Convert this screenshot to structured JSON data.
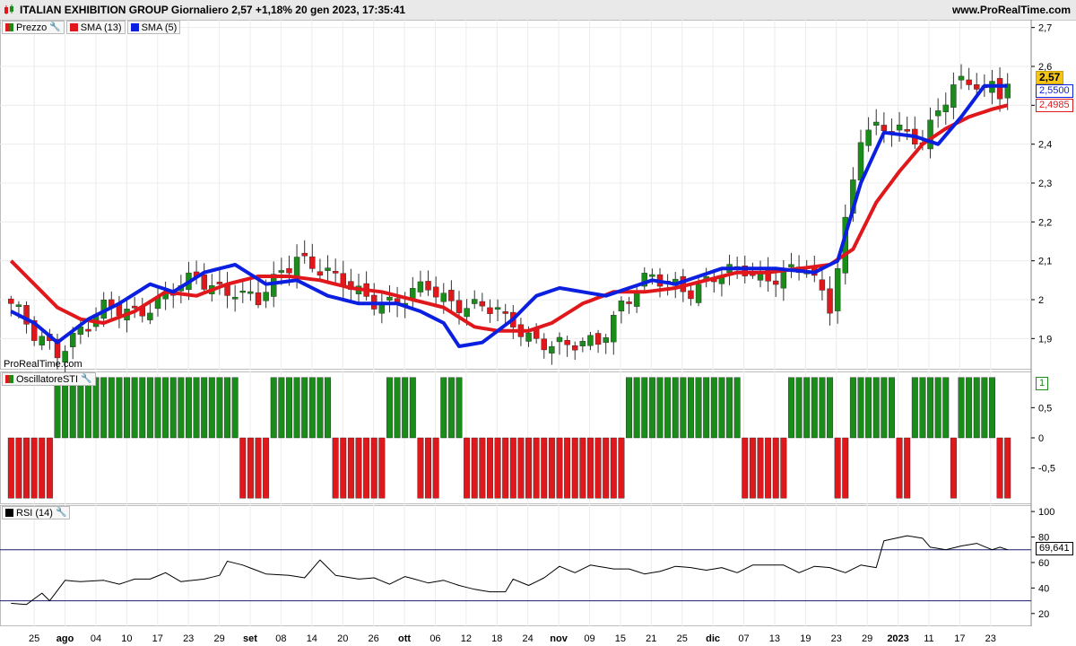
{
  "header": {
    "title": "ITALIAN EXHIBITION GROUP Giornaliero 2,57 +1,18% 20 gen 2023, 17:35:41",
    "site": "www.ProRealTime.com"
  },
  "watermark": "ProRealTime.com",
  "colors": {
    "up": "#1a8c1a",
    "down": "#e0171b",
    "sma13": "#e0171b",
    "sma5": "#0a1fe0",
    "rsi": "#000000",
    "axis": "#000000",
    "last_price_badge": "#f5c518"
  },
  "panels": {
    "price": {
      "legend": [
        {
          "label": "Prezzo",
          "icon": "candle-icon",
          "color": "#1a8c1a"
        },
        {
          "label": "SMA (13)",
          "color": "#e0171b"
        },
        {
          "label": "SMA (5)",
          "color": "#0a1fe0"
        }
      ],
      "yticks": [
        "2,7",
        "2,6",
        "2,5",
        "2,4",
        "2,3",
        "2,2",
        "2,1",
        "2",
        "1,9"
      ],
      "badges": {
        "last": "2,57",
        "sma5": "2,5500",
        "sma13": "2,4985"
      }
    },
    "osc": {
      "legend": [
        {
          "label": "OscillatoreSTI",
          "color": "#e0171b"
        }
      ],
      "yticks": [
        "0,5",
        "0",
        "-0,5"
      ],
      "badge": "1"
    },
    "rsi": {
      "legend": [
        {
          "label": "RSI (14)",
          "color": "#000000"
        }
      ],
      "yticks": [
        "100",
        "80",
        "60",
        "40",
        "20"
      ],
      "badge": "69,641"
    }
  },
  "xaxis": [
    {
      "label": "25",
      "bold": false
    },
    {
      "label": "ago",
      "bold": true
    },
    {
      "label": "04",
      "bold": false
    },
    {
      "label": "10",
      "bold": false
    },
    {
      "label": "17",
      "bold": false
    },
    {
      "label": "23",
      "bold": false
    },
    {
      "label": "29",
      "bold": false
    },
    {
      "label": "set",
      "bold": true
    },
    {
      "label": "08",
      "bold": false
    },
    {
      "label": "14",
      "bold": false
    },
    {
      "label": "20",
      "bold": false
    },
    {
      "label": "26",
      "bold": false
    },
    {
      "label": "ott",
      "bold": true
    },
    {
      "label": "06",
      "bold": false
    },
    {
      "label": "12",
      "bold": false
    },
    {
      "label": "18",
      "bold": false
    },
    {
      "label": "24",
      "bold": false
    },
    {
      "label": "nov",
      "bold": true
    },
    {
      "label": "09",
      "bold": false
    },
    {
      "label": "15",
      "bold": false
    },
    {
      "label": "21",
      "bold": false
    },
    {
      "label": "25",
      "bold": false
    },
    {
      "label": "dic",
      "bold": true
    },
    {
      "label": "07",
      "bold": false
    },
    {
      "label": "13",
      "bold": false
    },
    {
      "label": "19",
      "bold": false
    },
    {
      "label": "23",
      "bold": false
    },
    {
      "label": "29",
      "bold": false
    },
    {
      "label": "2023",
      "bold": true
    },
    {
      "label": "11",
      "bold": false
    },
    {
      "label": "17",
      "bold": false
    },
    {
      "label": "23",
      "bold": false
    }
  ],
  "chart_data": {
    "type": "candlestick",
    "n_bars": 130,
    "ylim": [
      1.82,
      2.72
    ],
    "price_points": [
      [
        0,
        1.99
      ],
      [
        3,
        1.9
      ],
      [
        6,
        1.87
      ],
      [
        9,
        1.93
      ],
      [
        12,
        1.97
      ],
      [
        16,
        1.97
      ],
      [
        20,
        2.01
      ],
      [
        24,
        2.05
      ],
      [
        28,
        2.03
      ],
      [
        32,
        1.99
      ],
      [
        37,
        2.12
      ],
      [
        42,
        2.05
      ],
      [
        46,
        2.01
      ],
      [
        50,
        1.99
      ],
      [
        54,
        2.03
      ],
      [
        57,
        2.0
      ],
      [
        62,
        1.97
      ],
      [
        65,
        1.94
      ],
      [
        68,
        1.9
      ],
      [
        72,
        1.87
      ],
      [
        76,
        1.9
      ],
      [
        79,
        1.99
      ],
      [
        82,
        2.04
      ],
      [
        85,
        2.05
      ],
      [
        88,
        2.03
      ],
      [
        91,
        2.05
      ],
      [
        95,
        2.08
      ],
      [
        98,
        2.06
      ],
      [
        103,
        2.07
      ],
      [
        106,
        1.99
      ],
      [
        110,
        2.42
      ],
      [
        115,
        2.44
      ],
      [
        118,
        2.42
      ],
      [
        122,
        2.54
      ],
      [
        125,
        2.56
      ],
      [
        126,
        2.55
      ],
      [
        127,
        2.56
      ],
      [
        128,
        2.54
      ],
      [
        129,
        2.57
      ]
    ],
    "sma5_points": [
      [
        0,
        1.97
      ],
      [
        3,
        1.94
      ],
      [
        6,
        1.89
      ],
      [
        10,
        1.95
      ],
      [
        14,
        1.99
      ],
      [
        18,
        2.04
      ],
      [
        21,
        2.02
      ],
      [
        25,
        2.07
      ],
      [
        29,
        2.09
      ],
      [
        33,
        2.04
      ],
      [
        37,
        2.05
      ],
      [
        41,
        2.01
      ],
      [
        45,
        1.99
      ],
      [
        50,
        1.99
      ],
      [
        53,
        1.97
      ],
      [
        56,
        1.94
      ],
      [
        58,
        1.88
      ],
      [
        61,
        1.89
      ],
      [
        65,
        1.95
      ],
      [
        68,
        2.01
      ],
      [
        71,
        2.03
      ],
      [
        74,
        2.02
      ],
      [
        77,
        2.01
      ],
      [
        80,
        2.03
      ],
      [
        83,
        2.05
      ],
      [
        86,
        2.04
      ],
      [
        89,
        2.06
      ],
      [
        92,
        2.08
      ],
      [
        95,
        2.08
      ],
      [
        99,
        2.08
      ],
      [
        104,
        2.07
      ],
      [
        107,
        2.1
      ],
      [
        110,
        2.3
      ],
      [
        113,
        2.43
      ],
      [
        117,
        2.42
      ],
      [
        120,
        2.4
      ],
      [
        123,
        2.47
      ],
      [
        126,
        2.55
      ],
      [
        129,
        2.55
      ]
    ],
    "sma13_points": [
      [
        0,
        2.1
      ],
      [
        3,
        2.04
      ],
      [
        6,
        1.98
      ],
      [
        9,
        1.95
      ],
      [
        12,
        1.94
      ],
      [
        16,
        1.97
      ],
      [
        20,
        2.02
      ],
      [
        24,
        2.01
      ],
      [
        28,
        2.04
      ],
      [
        32,
        2.06
      ],
      [
        36,
        2.06
      ],
      [
        40,
        2.05
      ],
      [
        44,
        2.03
      ],
      [
        48,
        2.02
      ],
      [
        52,
        2.0
      ],
      [
        56,
        1.98
      ],
      [
        60,
        1.93
      ],
      [
        63,
        1.92
      ],
      [
        67,
        1.92
      ],
      [
        70,
        1.94
      ],
      [
        74,
        1.99
      ],
      [
        78,
        2.02
      ],
      [
        82,
        2.02
      ],
      [
        86,
        2.03
      ],
      [
        90,
        2.05
      ],
      [
        94,
        2.07
      ],
      [
        98,
        2.07
      ],
      [
        102,
        2.08
      ],
      [
        106,
        2.09
      ],
      [
        109,
        2.13
      ],
      [
        112,
        2.25
      ],
      [
        115,
        2.33
      ],
      [
        118,
        2.4
      ],
      [
        121,
        2.44
      ],
      [
        124,
        2.47
      ],
      [
        127,
        2.49
      ],
      [
        129,
        2.5
      ]
    ],
    "oscillator": {
      "ylim": [
        -1.1,
        1.1
      ],
      "runs": [
        [
          6,
          -1
        ],
        [
          24,
          1
        ],
        [
          4,
          -1
        ],
        [
          8,
          1
        ],
        [
          7,
          -1
        ],
        [
          4,
          1
        ],
        [
          3,
          -1
        ],
        [
          3,
          1
        ],
        [
          21,
          -1
        ],
        [
          15,
          1
        ],
        [
          6,
          -1
        ],
        [
          6,
          1
        ],
        [
          2,
          -1
        ],
        [
          6,
          1
        ],
        [
          2,
          -1
        ],
        [
          5,
          1
        ],
        [
          1,
          -1
        ],
        [
          5,
          1
        ],
        [
          5,
          -1
        ],
        [
          11,
          1
        ],
        [
          2,
          -1
        ],
        [
          10,
          1
        ]
      ]
    },
    "rsi": {
      "ylim": [
        10,
        105
      ],
      "levels": [
        70,
        30
      ],
      "points": [
        [
          0,
          28
        ],
        [
          2,
          27
        ],
        [
          4,
          36
        ],
        [
          5,
          30
        ],
        [
          7,
          46
        ],
        [
          9,
          45
        ],
        [
          12,
          46
        ],
        [
          14,
          43
        ],
        [
          16,
          47
        ],
        [
          18,
          47
        ],
        [
          20,
          52
        ],
        [
          22,
          45
        ],
        [
          25,
          47
        ],
        [
          27,
          50
        ],
        [
          28,
          61
        ],
        [
          30,
          58
        ],
        [
          33,
          51
        ],
        [
          36,
          50
        ],
        [
          38,
          48
        ],
        [
          40,
          62
        ],
        [
          42,
          50
        ],
        [
          45,
          47
        ],
        [
          47,
          48
        ],
        [
          49,
          43
        ],
        [
          51,
          49
        ],
        [
          54,
          44
        ],
        [
          56,
          46
        ],
        [
          58,
          42
        ],
        [
          60,
          39
        ],
        [
          62,
          37
        ],
        [
          64,
          37
        ],
        [
          65,
          47
        ],
        [
          67,
          42
        ],
        [
          69,
          48
        ],
        [
          71,
          57
        ],
        [
          73,
          52
        ],
        [
          75,
          58
        ],
        [
          78,
          55
        ],
        [
          80,
          55
        ],
        [
          82,
          51
        ],
        [
          84,
          53
        ],
        [
          86,
          57
        ],
        [
          88,
          56
        ],
        [
          90,
          54
        ],
        [
          92,
          56
        ],
        [
          94,
          52
        ],
        [
          96,
          58
        ],
        [
          98,
          58
        ],
        [
          100,
          58
        ],
        [
          102,
          52
        ],
        [
          104,
          57
        ],
        [
          106,
          56
        ],
        [
          108,
          52
        ],
        [
          110,
          58
        ],
        [
          112,
          56
        ],
        [
          113,
          77
        ],
        [
          116,
          81
        ],
        [
          118,
          79
        ],
        [
          119,
          72
        ],
        [
          121,
          70
        ],
        [
          123,
          73
        ],
        [
          125,
          75
        ],
        [
          127,
          70
        ],
        [
          128,
          72
        ],
        [
          129,
          70
        ]
      ]
    }
  }
}
